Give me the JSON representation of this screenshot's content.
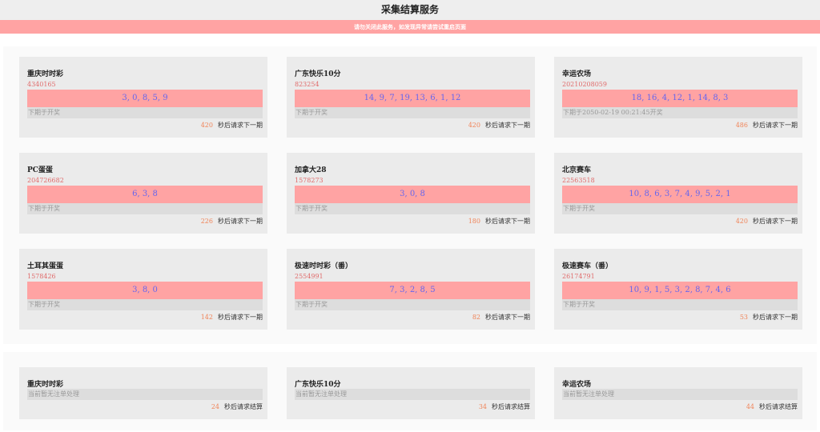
{
  "header": {
    "title": "采集结算服务"
  },
  "warning": {
    "text": "请勿关闭此服务，如发现异常请尝试重启页面"
  },
  "lotteries": [
    {
      "name": "重庆时时彩",
      "issue": "4340165",
      "numbers": "3, 0, 8, 5, 9",
      "next": "下期于开奖",
      "countdown": "420",
      "suffix": "秒后请求下一期"
    },
    {
      "name": "广东快乐10分",
      "issue": "823254",
      "numbers": "14, 9, 7, 19, 13, 6, 1, 12",
      "next": "下期于开奖",
      "countdown": "420",
      "suffix": "秒后请求下一期"
    },
    {
      "name": "幸运农场",
      "issue": "20210208059",
      "numbers": "18, 16, 4, 12, 1, 14, 8, 3",
      "next": "下期于2050-02-19 00:21:45开奖",
      "countdown": "486",
      "suffix": "秒后请求下一期"
    },
    {
      "name": "PC蛋蛋",
      "issue": "204726682",
      "numbers": "6, 3, 8",
      "next": "下期于开奖",
      "countdown": "226",
      "suffix": "秒后请求下一期"
    },
    {
      "name": "加拿大28",
      "issue": "1578273",
      "numbers": "3, 0, 8",
      "next": "下期于开奖",
      "countdown": "180",
      "suffix": "秒后请求下一期"
    },
    {
      "name": "北京赛车",
      "issue": "22563518",
      "numbers": "10, 8, 6, 3, 7, 4, 9, 5, 2, 1",
      "next": "下期于开奖",
      "countdown": "420",
      "suffix": "秒后请求下一期"
    },
    {
      "name": "土耳其蛋蛋",
      "issue": "1578426",
      "numbers": "3, 8, 0",
      "next": "下期于开奖",
      "countdown": "142",
      "suffix": "秒后请求下一期"
    },
    {
      "name": "极速时时彩（番）",
      "issue": "2554991",
      "numbers": "7, 3, 2, 8, 5",
      "next": "下期于开奖",
      "countdown": "82",
      "suffix": "秒后请求下一期"
    },
    {
      "name": "极速赛车（番）",
      "issue": "26174791",
      "numbers": "10, 9, 1, 5, 3, 2, 8, 7, 4, 6",
      "next": "下期于开奖",
      "countdown": "53",
      "suffix": "秒后请求下一期"
    }
  ],
  "settlements": [
    {
      "name": "重庆时时彩",
      "status": "当前暂无注单处理",
      "countdown": "24",
      "suffix": "秒后请求结算"
    },
    {
      "name": "广东快乐10分",
      "status": "当前暂无注单处理",
      "countdown": "34",
      "suffix": "秒后请求结算"
    },
    {
      "name": "幸运农场",
      "status": "当前暂无注单处理",
      "countdown": "44",
      "suffix": "秒后请求结算"
    }
  ]
}
